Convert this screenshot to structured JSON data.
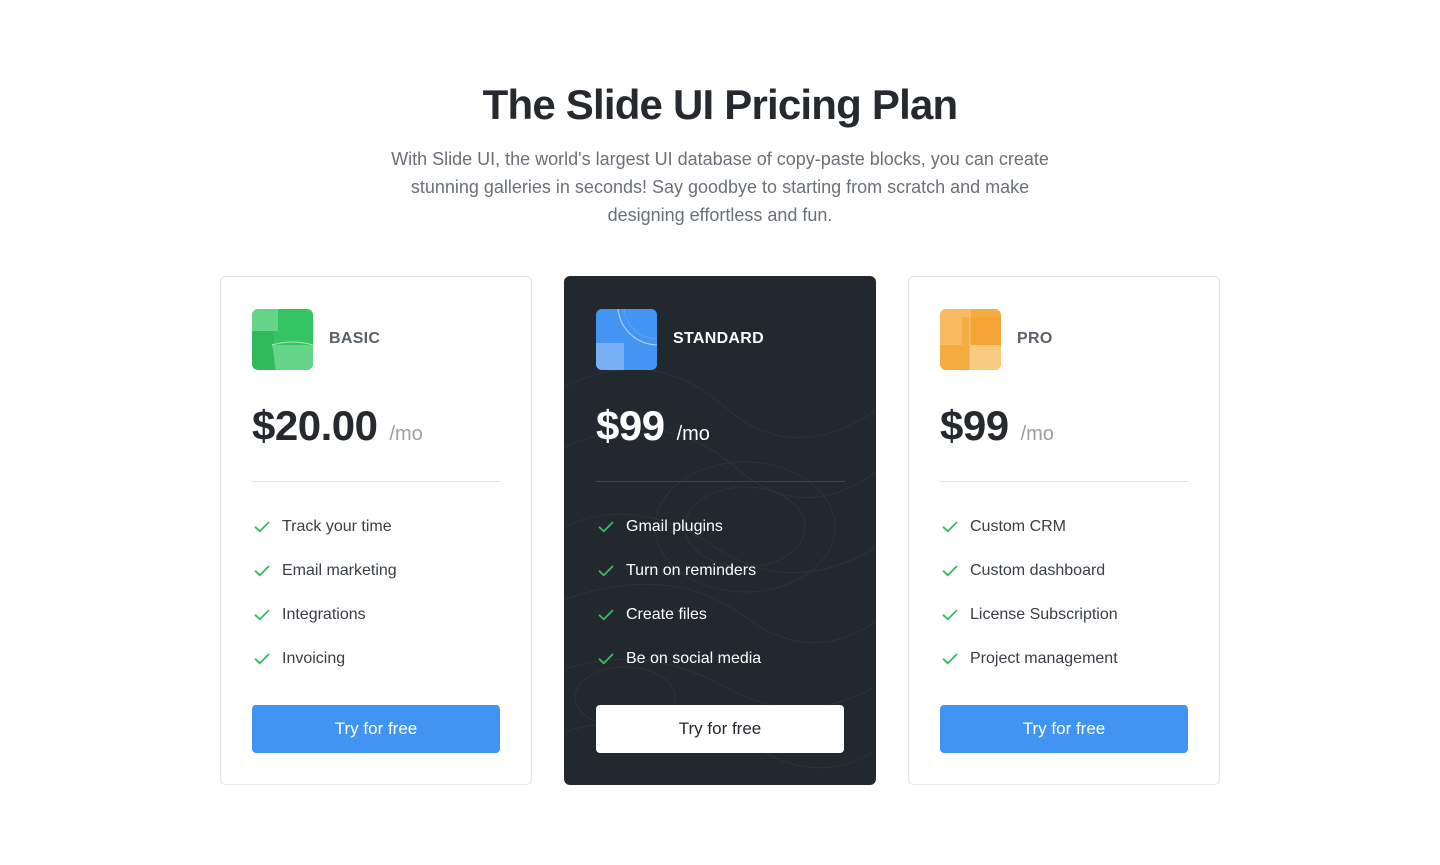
{
  "header": {
    "title": "The Slide UI Pricing Plan",
    "subtitle": "With Slide UI, the world's largest UI database of copy-paste blocks, you can create stunning galleries in seconds! Say goodbye to starting from scratch and make designing effortless and fun."
  },
  "plans": [
    {
      "name": "BASIC",
      "price": "$20.00",
      "unit": "/mo",
      "logo_color": "#34c463",
      "logo_icon": "plan-logo-basic-icon",
      "features": [
        {
          "label": "Track your time"
        },
        {
          "label": "Email marketing"
        },
        {
          "label": "Integrations"
        },
        {
          "label": "Invoicing"
        }
      ],
      "cta": "Try for free"
    },
    {
      "name": "STANDARD",
      "price": "$99",
      "unit": "/mo",
      "logo_color": "#3d8ff0",
      "logo_icon": "plan-logo-standard-icon",
      "highlighted": true,
      "features": [
        {
          "label": "Gmail plugins"
        },
        {
          "label": "Turn on reminders"
        },
        {
          "label": "Create files"
        },
        {
          "label": "Be on social media"
        }
      ],
      "cta": "Try for free"
    },
    {
      "name": "PRO",
      "price": "$99",
      "unit": "/mo",
      "logo_color": "#f5ac3f",
      "logo_icon": "plan-logo-pro-icon",
      "features": [
        {
          "label": "Custom CRM"
        },
        {
          "label": "Custom dashboard"
        },
        {
          "label": "License Subscription"
        },
        {
          "label": "Project management"
        }
      ],
      "cta": "Try for free"
    }
  ],
  "colors": {
    "accent": "#4095f2",
    "check": "#2fbf5f",
    "dark_card": "#22282d",
    "heading": "#262a2e",
    "muted": "#6b7178"
  }
}
